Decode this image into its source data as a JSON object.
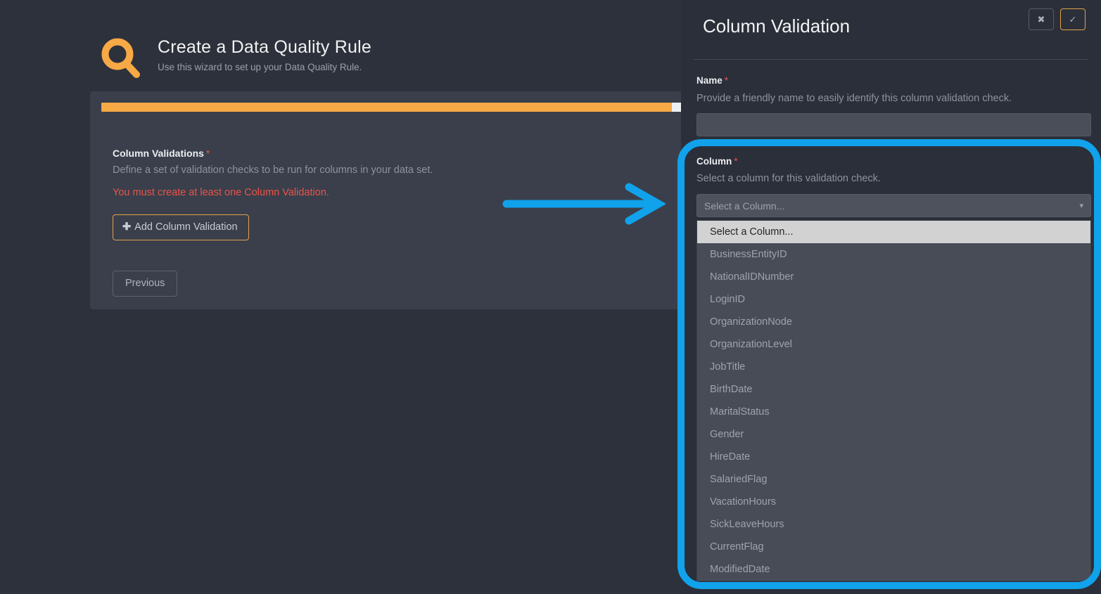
{
  "wizard": {
    "title": "Create a Data Quality Rule",
    "subtitle": "Use this wizard to set up your Data Quality Rule.",
    "icon": "magnifier-icon",
    "progress_percent": 98,
    "section": {
      "label": "Column Validations",
      "required_marker": "*",
      "description": "Define a set of validation checks to be run for columns in your data set.",
      "error": "You must create at least one Column Validation."
    },
    "buttons": {
      "add_label": "Add Column Validation",
      "add_icon": "plus-icon",
      "previous_label": "Previous"
    }
  },
  "annotation": {
    "arrow": "blue-arrow-right",
    "arrow_color": "#11a2ec",
    "highlight_color": "#11a2ec"
  },
  "panel": {
    "title": "Column Validation",
    "actions": {
      "cancel_icon": "✖",
      "cancel_name": "close-icon",
      "confirm_icon": "✓",
      "confirm_name": "check-icon"
    },
    "name_field": {
      "label": "Name",
      "required_marker": "*",
      "description": "Provide a friendly name to easily identify this column validation check.",
      "value": "",
      "placeholder": ""
    },
    "column_field": {
      "label": "Column",
      "required_marker": "*",
      "description": "Select a column for this validation check.",
      "selected": "Select a Column...",
      "caret_icon": "chevron-down-icon",
      "expanded": true,
      "options": [
        "Select a Column...",
        "BusinessEntityID",
        "NationalIDNumber",
        "LoginID",
        "OrganizationNode",
        "OrganizationLevel",
        "JobTitle",
        "BirthDate",
        "MaritalStatus",
        "Gender",
        "HireDate",
        "SalariedFlag",
        "VacationHours",
        "SickLeaveHours",
        "CurrentFlag",
        "ModifiedDate"
      ]
    }
  },
  "colors": {
    "page_bg": "#2d313b",
    "card_bg": "#3a3f4b",
    "panel_bg": "#2b2f39",
    "accent_orange": "#f6a945",
    "error_red": "#e8544a",
    "highlight_blue": "#11a2ec"
  }
}
